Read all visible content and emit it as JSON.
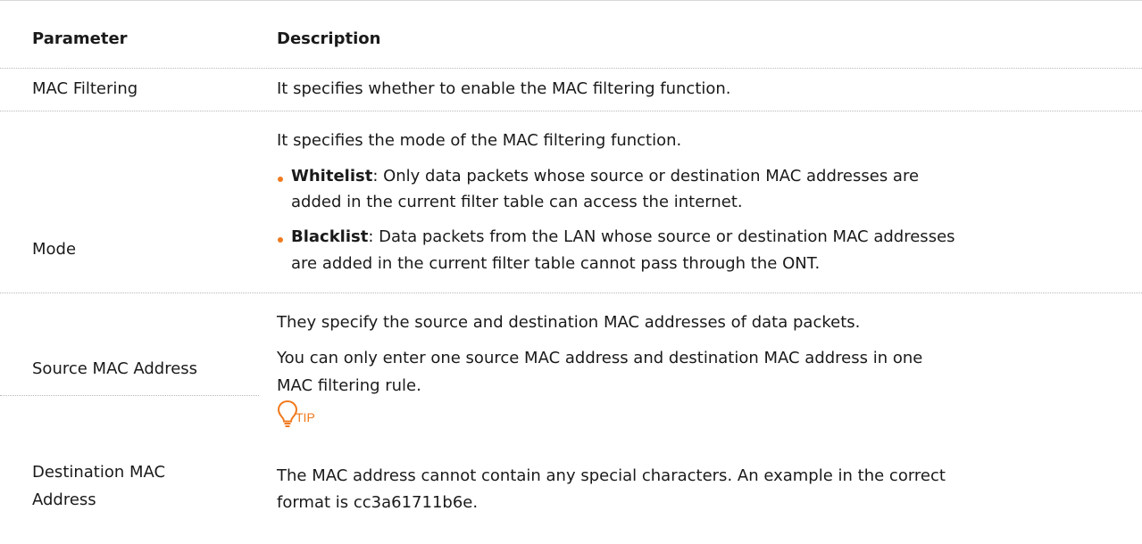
{
  "table": {
    "header": {
      "parameter": "Parameter",
      "description": "Description"
    },
    "rows": [
      {
        "parameter": "MAC Filtering",
        "description": "It specifies whether to enable the MAC filtering function."
      },
      {
        "parameter": "Mode",
        "description": "It specifies the mode of the MAC filtering function.",
        "bullets": [
          {
            "term": "Whitelist",
            "line1": ": Only data packets whose source or destination MAC addresses are",
            "line2": "added in the current filter table can access the internet."
          },
          {
            "term": "Blacklist",
            "line1": ": Data packets from the LAN whose source or destination MAC addresses",
            "line2": "are added in the current filter table cannot pass through the ONT."
          }
        ]
      },
      {
        "parameter_1": "Source MAC Address",
        "parameter_2_line1": "Destination MAC",
        "parameter_2_line2": "Address",
        "desc_line1": "They specify the source and destination MAC addresses of data packets.",
        "desc_line2": "You can only enter one source MAC address and destination MAC address in one",
        "desc_line3": "MAC filtering rule.",
        "tip_label": "TIP",
        "tip_line1": "The MAC address cannot contain any special characters. An example in the correct",
        "tip_line2": "format is cc3a61711b6e."
      }
    ]
  },
  "colors": {
    "accent": "#f07a1f",
    "text": "#1a1a1a",
    "rule": "#b8b8b8"
  },
  "icons": {
    "tip": "lightbulb-icon"
  }
}
